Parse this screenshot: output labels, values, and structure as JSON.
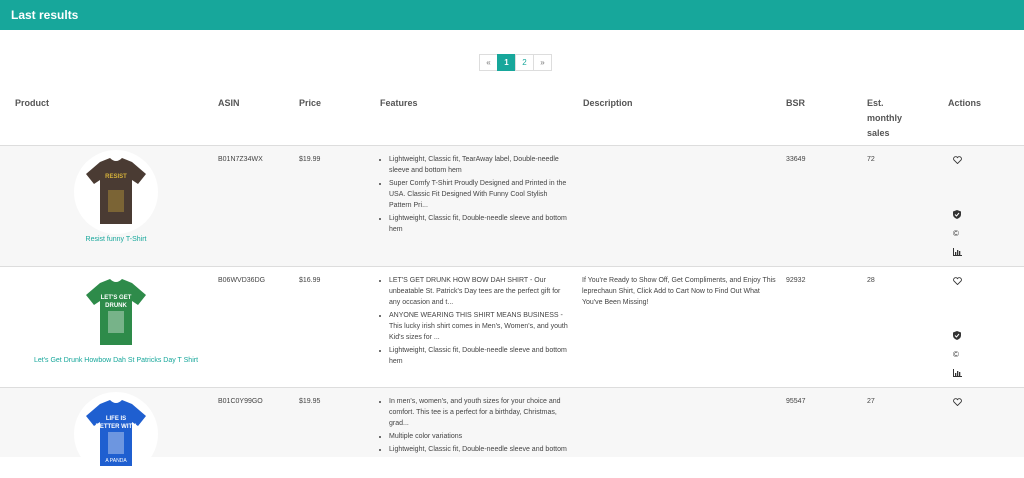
{
  "header": {
    "title": "Last results"
  },
  "pagination": {
    "prev": "«",
    "pages": [
      "1",
      "2"
    ],
    "active": "1",
    "next": "»"
  },
  "columns": {
    "product": "Product",
    "asin": "ASIN",
    "price": "Price",
    "features": "Features",
    "description": "Description",
    "bsr": "BSR",
    "sales": [
      "Est.",
      "monthly",
      "sales"
    ],
    "actions": "Actions"
  },
  "rows": [
    {
      "name": "Resist funny T-Shirt",
      "shirt_color": "#4a3b33",
      "print_text": "RESIST",
      "print_color": "#d6b23a",
      "asin": "B01N7Z34WX",
      "price": "$19.99",
      "features": [
        "Lightweight, Classic fit, TearAway label, Double-needle sleeve and bottom hem",
        "Super Comfy T-Shirt Proudly Designed and Printed in the USA. Classic Fit Designed With Funny Cool Stylish Pattern Pri...",
        "Lightweight, Classic fit, Double-needle sleeve and bottom hem"
      ],
      "description": "",
      "bsr": "33649",
      "sales": "72"
    },
    {
      "name": "Let's Get Drunk Howbow Dah St Patricks Day T Shirt",
      "shirt_color": "#2e8b4a",
      "print_text": "LET'S GET DRUNK",
      "print_color": "#ffffff",
      "asin": "B06WVD36DG",
      "price": "$16.99",
      "features": [
        "LET'S GET DRUNK HOW BOW DAH SHIRT - Our unbeatable St. Patrick's Day tees are the perfect gift for any occasion and t...",
        "ANYONE WEARING THIS SHIRT MEANS BUSINESS - This lucky irish shirt comes in Men's, Women's, and youth Kid's sizes for ...",
        "Lightweight, Classic fit, Double-needle sleeve and bottom hem"
      ],
      "description": "If You're Ready to Show Off, Get Compliments, and Enjoy This leprechaun Shirt, Click Add to Cart Now to Find Out What You've Been Missing!",
      "bsr": "92932",
      "sales": "28"
    },
    {
      "name": "",
      "shirt_color": "#1f5fd0",
      "print_text": "LIFE IS BETTER WITH A PANDA",
      "print_color": "#ffffff",
      "asin": "B01C0Y99GO",
      "price": "$19.95",
      "features": [
        "In men's, women's, and youth sizes for your choice and comfort. This tee is a perfect for a birthday, Christmas, grad...",
        "Multiple color variations",
        "Lightweight, Classic fit, Double-needle sleeve and bottom"
      ],
      "description": "",
      "bsr": "95547",
      "sales": "27"
    }
  ],
  "accent_color": "#17a79b"
}
